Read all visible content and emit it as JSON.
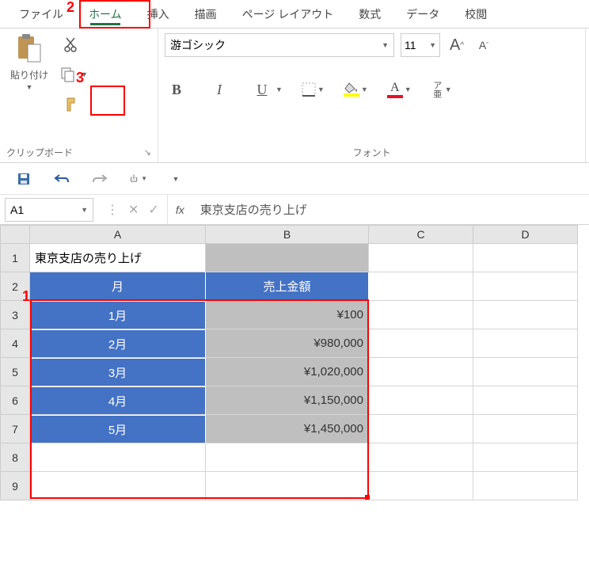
{
  "tabs": {
    "file": "ファイル",
    "home": "ホーム",
    "insert": "挿入",
    "draw": "描画",
    "layout": "ページ レイアウト",
    "formulas": "数式",
    "data": "データ",
    "review": "校閲"
  },
  "clipboard": {
    "paste_label": "貼り付け",
    "group_label": "クリップボード"
  },
  "font": {
    "name": "游ゴシック",
    "size": "11",
    "group_label": "フォント",
    "bold": "B",
    "italic": "I",
    "underline": "U",
    "bigA": "A",
    "smallA": "A",
    "phonetic": "ア亜"
  },
  "namebox": "A1",
  "fx": "fx",
  "formula_value": "東京支店の売り上げ",
  "columns": [
    "A",
    "B",
    "C",
    "D"
  ],
  "rows": [
    "1",
    "2",
    "3",
    "4",
    "5",
    "6",
    "7",
    "8",
    "9"
  ],
  "cells": {
    "A1": "東京支店の売り上げ",
    "A2": "月",
    "B2": "売上金額",
    "A3": "1月",
    "B3": "¥100",
    "A4": "2月",
    "B4": "¥980,000",
    "A5": "3月",
    "B5": "¥1,020,000",
    "A6": "4月",
    "B6": "¥1,150,000",
    "A7": "5月",
    "B7": "¥1,450,000"
  },
  "anno": {
    "l1": "1",
    "l2": "2",
    "l3": "3"
  },
  "colors": {
    "fill_highlight": "#ffff00",
    "font_color": "#e81123",
    "brand": "#217346",
    "table_header": "#4472c4"
  },
  "chart_data": {
    "type": "table",
    "title": "東京支店の売り上げ",
    "columns": [
      "月",
      "売上金額"
    ],
    "rows": [
      [
        "1月",
        100
      ],
      [
        "2月",
        980000
      ],
      [
        "3月",
        1020000
      ],
      [
        "4月",
        1150000
      ],
      [
        "5月",
        1450000
      ]
    ],
    "currency": "¥"
  }
}
